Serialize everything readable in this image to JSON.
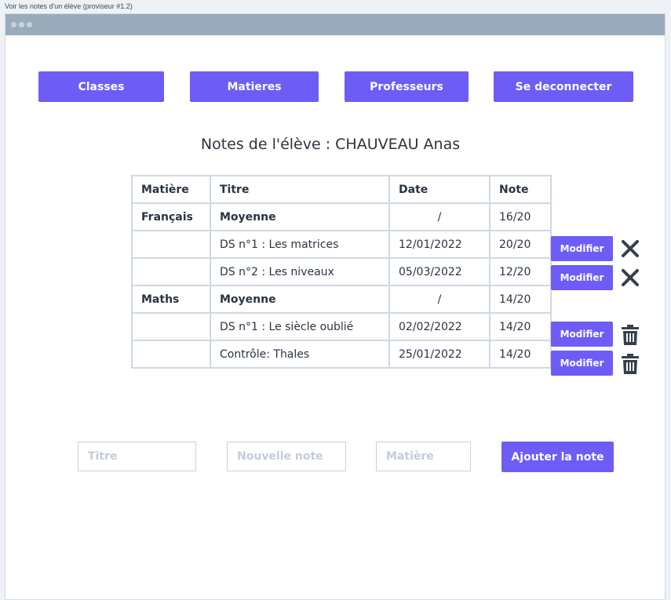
{
  "page_caption": "Voir les notes d'un élève (proviseur #1.2)",
  "nav": {
    "classes": "Classes",
    "matieres": "Matieres",
    "professeurs": "Professeurs",
    "logout": "Se deconnecter"
  },
  "heading": "Notes de l'élève : CHAUVEAU Anas",
  "table": {
    "headers": [
      "Matière",
      "Titre",
      "Date",
      "Note"
    ],
    "rows": [
      {
        "matiere": "Français",
        "titre": "Moyenne",
        "date": "/",
        "note": "16/20"
      },
      {
        "matiere": "",
        "titre": "DS n°1 : Les matrices",
        "date": "12/01/2022",
        "note": "20/20"
      },
      {
        "matiere": "",
        "titre": "DS n°2 : Les niveaux",
        "date": "05/03/2022",
        "note": "12/20"
      },
      {
        "matiere": "Maths",
        "titre": "Moyenne",
        "date": "/",
        "note": "14/20"
      },
      {
        "matiere": "",
        "titre": "DS n°1 : Le siècle oublié",
        "date": "02/02/2022",
        "note": "14/20"
      },
      {
        "matiere": "",
        "titre": "Contrôle: Thales",
        "date": "25/01/2022",
        "note": "14/20"
      }
    ]
  },
  "row_actions": {
    "modify_label": "Modifier",
    "icons": [
      "close-icon",
      "close-icon",
      "trash-icon",
      "trash-icon"
    ]
  },
  "form": {
    "titre_placeholder": "Titre",
    "note_placeholder": "Nouvelle note",
    "matiere_placeholder": "Matière",
    "submit_label": "Ajouter la note"
  },
  "colors": {
    "accent": "#6d5cf6",
    "titlebar": "#9aabbb",
    "icon": "#34404d"
  }
}
